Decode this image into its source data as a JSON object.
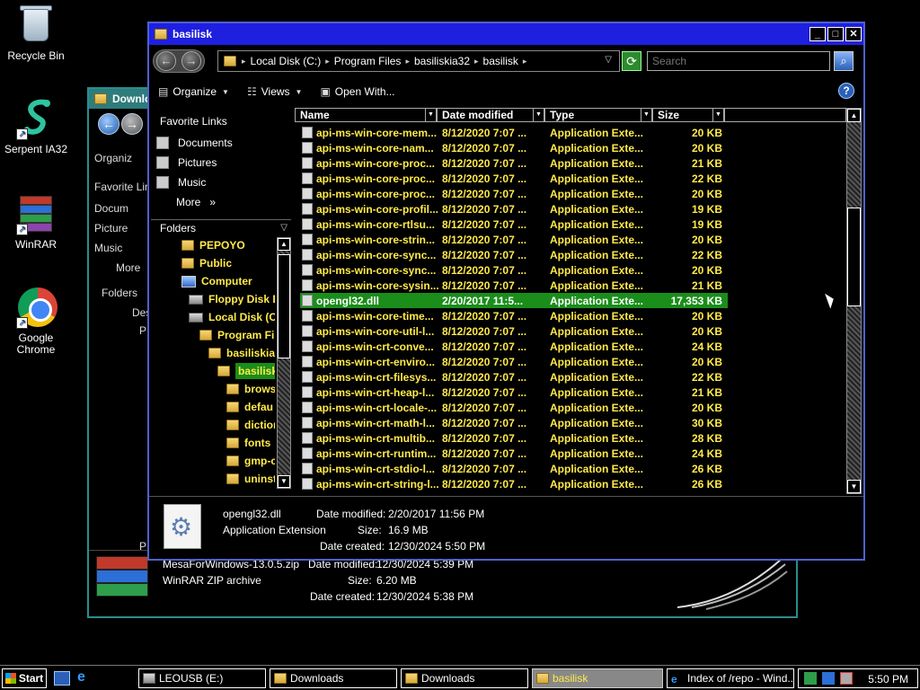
{
  "desktop": {
    "icons": [
      {
        "label": "Recycle Bin"
      },
      {
        "label": "Serpent IA32"
      },
      {
        "label": "WinRAR"
      },
      {
        "label": "Google Chrome"
      }
    ]
  },
  "bg_window": {
    "title": "Downlo",
    "toolbar_partial": "Organiz",
    "left_items": [
      "Favorite Lin",
      "Docum",
      "Picture",
      "Music",
      "More",
      "Folders",
      "Des",
      "P",
      "P"
    ],
    "details": {
      "file_name": "MesaForWindows-13.0.5.zip",
      "file_type": "WinRAR ZIP archive",
      "date_modified_label": "Date modified:",
      "date_modified": "12/30/2024 5:39 PM",
      "size_label": "Size:",
      "size": "6.20 MB",
      "date_created_label": "Date created:",
      "date_created": "12/30/2024 5:38 PM"
    }
  },
  "window": {
    "title": "basilisk",
    "address": [
      "Local Disk (C:)",
      "Program Files",
      "basiliskia32",
      "basilisk"
    ],
    "search_placeholder": "Search",
    "toolbar": {
      "organize": "Organize",
      "views": "Views",
      "open_with": "Open With..."
    },
    "favorites_header": "Favorite Links",
    "favorites": [
      "Documents",
      "Pictures",
      "Music",
      "More"
    ],
    "more_chevron": "»",
    "folders_header": "Folders",
    "tree": [
      "PEPOYO",
      "Public",
      "Computer",
      "Floppy Disk D",
      "Local Disk (C",
      "Program Fil",
      "basiliskia",
      "basilisk",
      "brows",
      "defau",
      "diction",
      "fonts",
      "gmp-c",
      "uninst"
    ],
    "columns": {
      "name": "Name",
      "date": "Date modified",
      "type": "Type",
      "size": "Size"
    },
    "files": [
      {
        "name": "api-ms-win-core-mem...",
        "date": "8/12/2020 7:07 ...",
        "type": "Application Exte...",
        "size": "20 KB"
      },
      {
        "name": "api-ms-win-core-nam...",
        "date": "8/12/2020 7:07 ...",
        "type": "Application Exte...",
        "size": "20 KB"
      },
      {
        "name": "api-ms-win-core-proc...",
        "date": "8/12/2020 7:07 ...",
        "type": "Application Exte...",
        "size": "21 KB"
      },
      {
        "name": "api-ms-win-core-proc...",
        "date": "8/12/2020 7:07 ...",
        "type": "Application Exte...",
        "size": "22 KB"
      },
      {
        "name": "api-ms-win-core-proc...",
        "date": "8/12/2020 7:07 ...",
        "type": "Application Exte...",
        "size": "20 KB"
      },
      {
        "name": "api-ms-win-core-profil...",
        "date": "8/12/2020 7:07 ...",
        "type": "Application Exte...",
        "size": "19 KB"
      },
      {
        "name": "api-ms-win-core-rtlsu...",
        "date": "8/12/2020 7:07 ...",
        "type": "Application Exte...",
        "size": "19 KB"
      },
      {
        "name": "api-ms-win-core-strin...",
        "date": "8/12/2020 7:07 ...",
        "type": "Application Exte...",
        "size": "20 KB"
      },
      {
        "name": "api-ms-win-core-sync...",
        "date": "8/12/2020 7:07 ...",
        "type": "Application Exte...",
        "size": "22 KB"
      },
      {
        "name": "api-ms-win-core-sync...",
        "date": "8/12/2020 7:07 ...",
        "type": "Application Exte...",
        "size": "20 KB"
      },
      {
        "name": "api-ms-win-core-sysin...",
        "date": "8/12/2020 7:07 ...",
        "type": "Application Exte...",
        "size": "21 KB"
      },
      {
        "name": "opengl32.dll",
        "date": "2/20/2017 11:5...",
        "type": "Application Exte...",
        "size": "17,353 KB",
        "selected": true
      },
      {
        "name": "api-ms-win-core-time...",
        "date": "8/12/2020 7:07 ...",
        "type": "Application Exte...",
        "size": "20 KB"
      },
      {
        "name": "api-ms-win-core-util-l...",
        "date": "8/12/2020 7:07 ...",
        "type": "Application Exte...",
        "size": "20 KB"
      },
      {
        "name": "api-ms-win-crt-conve...",
        "date": "8/12/2020 7:07 ...",
        "type": "Application Exte...",
        "size": "24 KB"
      },
      {
        "name": "api-ms-win-crt-enviro...",
        "date": "8/12/2020 7:07 ...",
        "type": "Application Exte...",
        "size": "20 KB"
      },
      {
        "name": "api-ms-win-crt-filesys...",
        "date": "8/12/2020 7:07 ...",
        "type": "Application Exte...",
        "size": "22 KB"
      },
      {
        "name": "api-ms-win-crt-heap-l...",
        "date": "8/12/2020 7:07 ...",
        "type": "Application Exte...",
        "size": "21 KB"
      },
      {
        "name": "api-ms-win-crt-locale-...",
        "date": "8/12/2020 7:07 ...",
        "type": "Application Exte...",
        "size": "20 KB"
      },
      {
        "name": "api-ms-win-crt-math-l...",
        "date": "8/12/2020 7:07 ...",
        "type": "Application Exte...",
        "size": "30 KB"
      },
      {
        "name": "api-ms-win-crt-multib...",
        "date": "8/12/2020 7:07 ...",
        "type": "Application Exte...",
        "size": "28 KB"
      },
      {
        "name": "api-ms-win-crt-runtim...",
        "date": "8/12/2020 7:07 ...",
        "type": "Application Exte...",
        "size": "24 KB"
      },
      {
        "name": "api-ms-win-crt-stdio-l...",
        "date": "8/12/2020 7:07 ...",
        "type": "Application Exte...",
        "size": "26 KB"
      },
      {
        "name": "api-ms-win-crt-string-l...",
        "date": "8/12/2020 7:07 ...",
        "type": "Application Exte...",
        "size": "26 KB"
      }
    ],
    "details": {
      "file_name": "opengl32.dll",
      "file_type": "Application Extension",
      "date_modified_label": "Date modified:",
      "date_modified": "2/20/2017 11:56 PM",
      "size_label": "Size:",
      "size": "16.9 MB",
      "date_created_label": "Date created:",
      "date_created": "12/30/2024 5:50 PM"
    }
  },
  "taskbar": {
    "start": "Start",
    "buttons": [
      "LEOUSB (E:)",
      "Downloads",
      "Downloads",
      "basilisk",
      "Index of /repo - Wind..."
    ],
    "clock": "5:50 PM"
  },
  "colors": {
    "selection": "#1a8d1a",
    "file_text": "#ffea4a",
    "title_bar": "#1f1fe0",
    "search_text": "#2bd92b"
  }
}
